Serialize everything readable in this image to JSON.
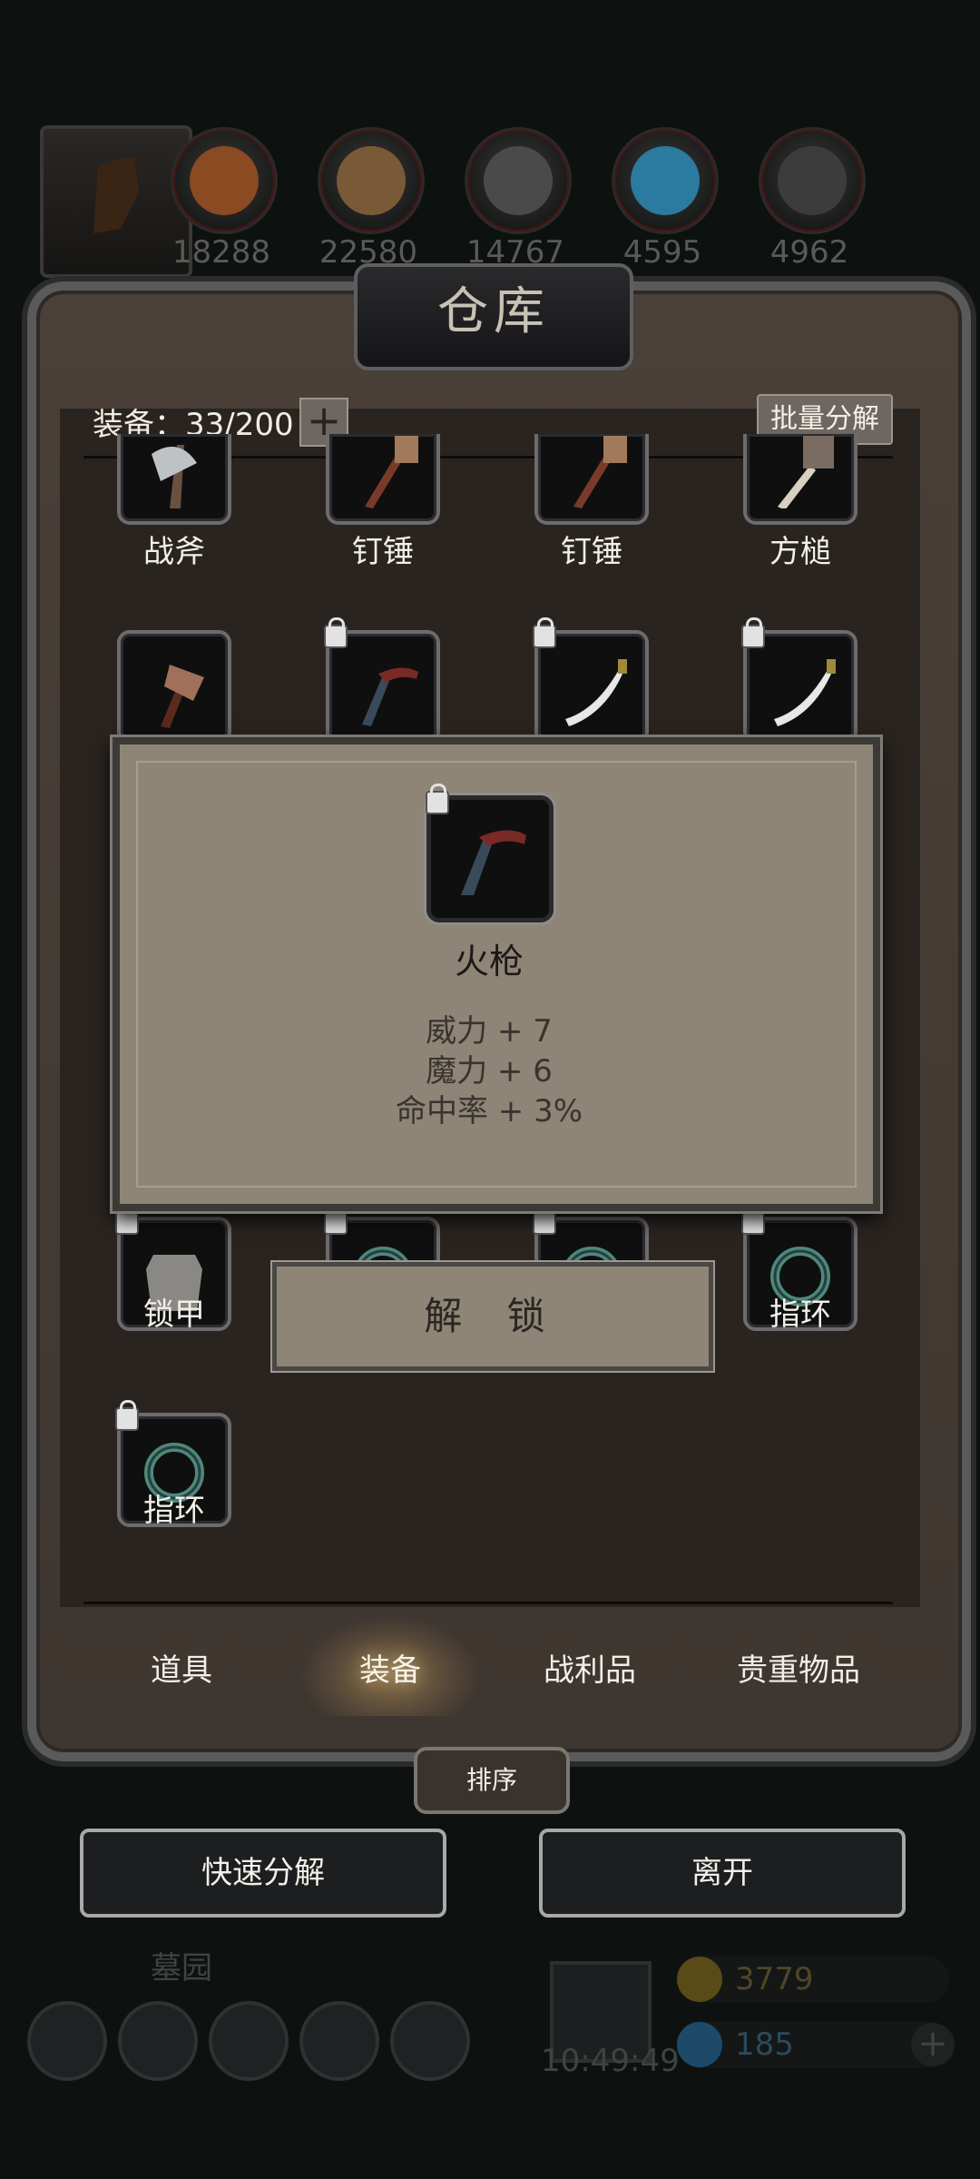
{
  "resources": [
    {
      "count": "18288",
      "icon": "wood-log-icon",
      "color": "#8a4a22"
    },
    {
      "count": "22580",
      "icon": "planks-icon",
      "color": "#7a5a36"
    },
    {
      "count": "14767",
      "icon": "iron-ingot-icon",
      "color": "#4a4a4a"
    },
    {
      "count": "4595",
      "icon": "crystal-icon",
      "color": "#2b7aa0"
    },
    {
      "count": "4962",
      "icon": "steel-ingot-icon",
      "color": "#3c3c3c"
    }
  ],
  "warehouse": {
    "title": "仓库",
    "equip_count": "装备：33/200",
    "batch_label": "批量分解"
  },
  "items": [
    {
      "label": "战斧",
      "icon": "battle-axe-icon",
      "locked": false
    },
    {
      "label": "钉锤",
      "icon": "spiked-hammer-icon",
      "locked": false
    },
    {
      "label": "钉锤",
      "icon": "spiked-hammer-icon",
      "locked": false
    },
    {
      "label": "方槌",
      "icon": "square-mallet-icon",
      "locked": false
    },
    {
      "label": "",
      "icon": "hammer-icon",
      "locked": false
    },
    {
      "label": "",
      "icon": "musket-icon",
      "locked": true
    },
    {
      "label": "",
      "icon": "scimitar-icon",
      "locked": true
    },
    {
      "label": "",
      "icon": "scimitar-icon",
      "locked": true
    },
    {
      "label": "锁甲",
      "icon": "chainmail-icon",
      "locked": true
    },
    {
      "label": "",
      "icon": "ring-icon",
      "locked": true
    },
    {
      "label": "",
      "icon": "ring-icon",
      "locked": true
    },
    {
      "label": "指环",
      "icon": "ring-icon",
      "locked": true
    },
    {
      "label": "指环",
      "icon": "ring-icon",
      "locked": true
    }
  ],
  "popup": {
    "name": "火枪",
    "stats": [
      "威力 + 7",
      "魔力 + 6",
      "命中率 + 3%"
    ],
    "icon": "musket-icon",
    "unlock_label": "解 锁"
  },
  "tabs": [
    {
      "label": "道具",
      "active": false
    },
    {
      "label": "装备",
      "active": true
    },
    {
      "label": "战利品",
      "active": false
    },
    {
      "label": "贵重物品",
      "active": false
    }
  ],
  "sort_label": "排序",
  "quick_decompose_label": "快速分解",
  "leave_label": "离开",
  "hud": {
    "location": "墓园",
    "timer": "10:49:49",
    "gold": "3779",
    "gems": "185"
  }
}
